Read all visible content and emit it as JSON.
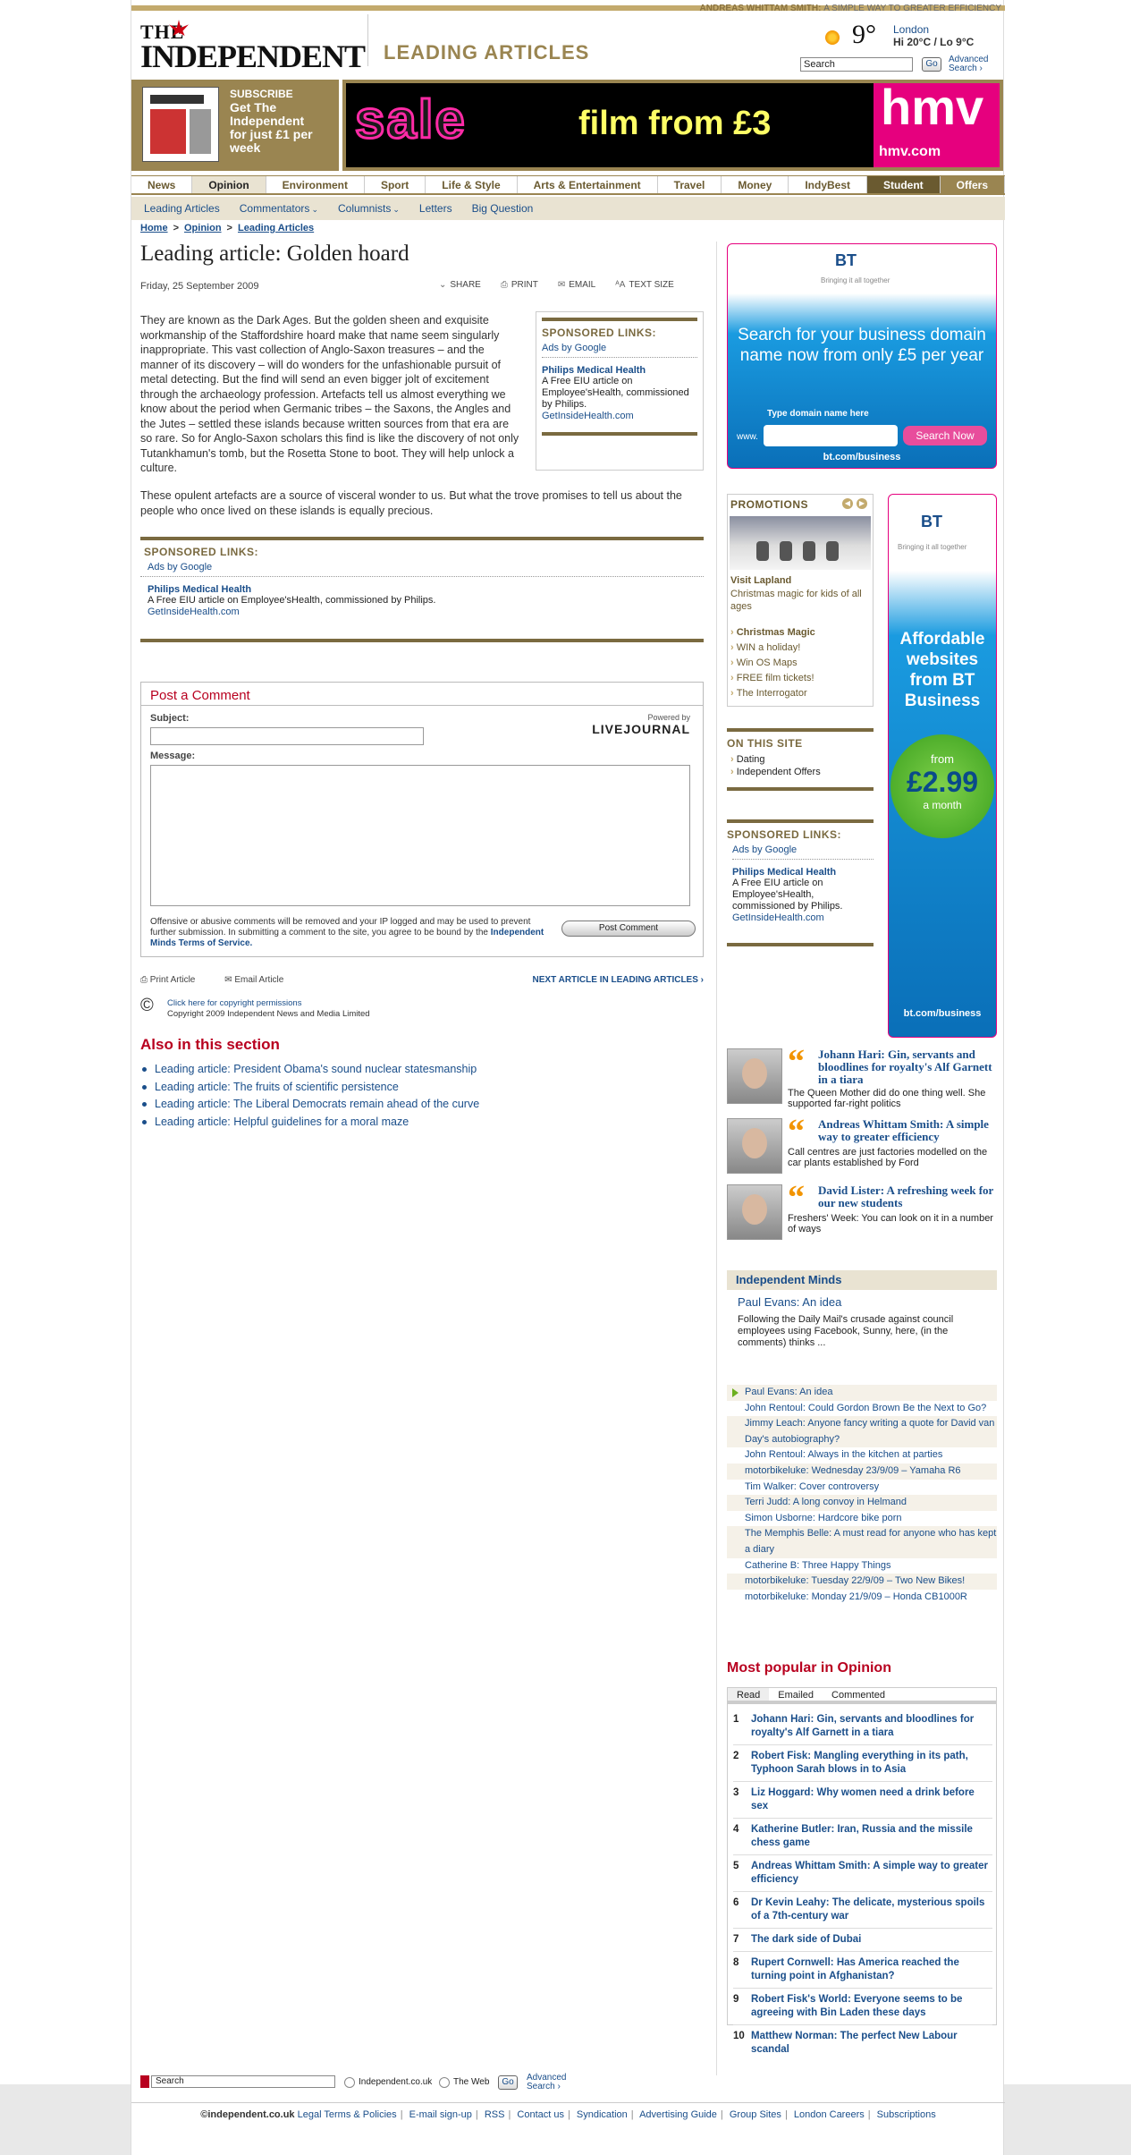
{
  "header": {
    "top_link_name": "ANDREAS WHITTAM SMITH:",
    "top_link_text": "A SIMPLE WAY TO GREATER EFFICIENCY",
    "logo_the": "THE",
    "logo_ind": "INDEPENDENT",
    "section_title": "LEADING ARTICLES",
    "weather_temp": "9°",
    "weather_city": "London",
    "weather_hilo": "Hi 20°C / Lo 9°C",
    "search_placeholder": "Search",
    "go": "Go",
    "advanced": "Advanced",
    "advanced2": "Search ›"
  },
  "subscribe": {
    "l1": "SUBSCRIBE",
    "l2": "Get The",
    "l3": "Independent",
    "l4": "for just £1 per",
    "l5": "week"
  },
  "banner": {
    "sale": "sale",
    "film": "film from £3",
    "brand": "hmv",
    "url": "hmv.com"
  },
  "nav": {
    "tabs": [
      "News",
      "Opinion",
      "Environment",
      "Sport",
      "Life & Style",
      "Arts & Entertainment",
      "Travel",
      "Money",
      "IndyBest",
      "Student",
      "Offers"
    ],
    "sub": [
      "Leading Articles",
      "Commentators",
      "Columnists",
      "Letters",
      "Big Question"
    ]
  },
  "breadcrumb": {
    "home": "Home",
    "opinion": "Opinion",
    "leading": "Leading Articles",
    "sep": ">"
  },
  "article": {
    "title": "Leading article: Golden hoard",
    "date": "Friday, 25 September 2009",
    "tools": [
      "SHARE",
      "PRINT",
      "EMAIL",
      "TEXT SIZE"
    ],
    "para1": "They are known as the Dark Ages. But the golden sheen and exquisite workmanship of the Staffordshire hoard make that name seem singularly inappropriate. This vast collection of Anglo-Saxon treasures – and the manner of its discovery – will do wonders for the unfashionable pursuit of metal detecting. But the find will send an even bigger jolt of excitement through the archaeology profession. Artefacts tell us almost everything we know about the period when Germanic tribes – the Saxons, the Angles and the Jutes – settled these islands because written sources from that era are so rare. So for Anglo-Saxon scholars this find is like the discovery of not only Tutankhamun's tomb, but the Rosetta Stone to boot. They will help unlock a culture.",
    "para2": "These opulent artefacts are a source of visceral wonder to us. But what the trove promises to tell us about the people who once lived on these islands is equally precious."
  },
  "sponsored": {
    "heading": "SPONSORED LINKS:",
    "ads": "Ads by Google",
    "title": "Philips Medical Health",
    "desc": "A Free EIU article on Employee'sHealth, commissioned by Philips.",
    "url": "GetInsideHealth.com"
  },
  "comment": {
    "heading": "Post a Comment",
    "subject": "Subject:",
    "message": "Message:",
    "powered": "Powered by",
    "lj": "LIVEJOURNAL",
    "note": "Offensive or abusive comments will be removed and your IP logged and may be used to prevent further submission. In submitting a comment to the site, you agree to be bound by the",
    "terms": "Independent Minds Terms of Service.",
    "post": "Post Comment"
  },
  "article_footer": {
    "print": "Print Article",
    "email": "Email Article",
    "next": "NEXT ARTICLE IN LEADING ARTICLES ›",
    "copyright_link": "Click here for copyright permissions",
    "copyright": "Copyright 2009 Independent News and Media Limited"
  },
  "also": {
    "heading": "Also in this section",
    "items": [
      "Leading article: President Obama's sound nuclear statesmanship",
      "Leading article: The fruits of scientific persistence",
      "Leading article: The Liberal Democrats remain ahead of the curve",
      "Leading article: Helpful guidelines for a moral maze"
    ]
  },
  "bt_ad": {
    "logo": "BT",
    "tag": "Bringing it all together",
    "headline": "Search for your business domain name now from only £5 per year",
    "label": "Type domain name here",
    "www": "www.",
    "button": "Search Now",
    "url": "bt.com/business"
  },
  "bt_ad2": {
    "headline": "Affordable websites from BT Business",
    "from": "from",
    "price": "£2.99",
    "month": "a month",
    "url": "bt.com/business"
  },
  "promotions": {
    "heading": "PROMOTIONS",
    "title": "Visit Lapland",
    "desc": "Christmas magic for kids of all ages",
    "items": [
      "Christmas Magic",
      "WIN a holiday!",
      "Win OS Maps",
      "FREE film tickets!",
      "The Interrogator"
    ]
  },
  "onsite": {
    "heading": "ON THIS SITE",
    "items": [
      "Dating",
      "Independent Offers"
    ]
  },
  "commentators": [
    {
      "title": "Johann Hari: Gin, servants and bloodlines for royalty's Alf Garnett in a tiara",
      "desc": "The Queen Mother did do one thing well. She supported far-right politics"
    },
    {
      "title": "Andreas Whittam Smith: A simple way to greater efficiency",
      "desc": "Call centres are just factories modelled on the car plants established by Ford"
    },
    {
      "title": "David Lister: A refreshing week for our new students",
      "desc": "Freshers' Week: You can look on it in a number of ways"
    }
  ],
  "minds": {
    "heading": "Independent Minds",
    "feature": "Paul Evans: An idea",
    "feature_desc": "Following the Daily Mail's crusade against council employees using Facebook, Sunny, here, (in the comments) thinks ...",
    "items": [
      "Paul Evans: An idea",
      "John Rentoul: Could Gordon Brown Be the Next to Go?",
      "Jimmy Leach: Anyone fancy writing a quote for David van Day's autobiography?",
      "John Rentoul: Always in the kitchen at parties",
      "motorbikeluke: Wednesday 23/9/09 – Yamaha R6",
      "Tim Walker: Cover controversy",
      "Terri Judd: A long convoy in Helmand",
      "Simon Usborne: Hardcore bike porn",
      "The Memphis Belle: A must read for anyone who has kept a diary",
      "Catherine B: Three Happy Things",
      "motorbikeluke: Tuesday 22/9/09 – Two New Bikes!",
      "motorbikeluke: Monday 21/9/09 – Honda CB1000R"
    ]
  },
  "popular": {
    "heading": "Most popular in Opinion",
    "tabs": [
      "Read",
      "Emailed",
      "Commented"
    ],
    "items": [
      "Johann Hari: Gin, servants and bloodlines for royalty's Alf Garnett in a tiara",
      "Robert Fisk: Mangling everything in its path, Typhoon Sarah blows in to Asia",
      "Liz Hoggard: Why women need a drink before sex",
      "Katherine Butler: Iran, Russia and the missile chess game",
      "Andreas Whittam Smith: A simple way to greater efficiency",
      "Dr Kevin Leahy: The delicate, mysterious spoils of a 7th-century war",
      "The dark side of Dubai",
      "Rupert Cornwell: Has America reached the turning point in Afghanistan?",
      "Robert Fisk's World: Everyone seems to be agreeing with Bin Laden these days",
      "Matthew Norman: The perfect New Labour scandal"
    ]
  },
  "footer_search": {
    "placeholder": "Search",
    "opt1": "Independent.co.uk",
    "opt2": "The Web",
    "go": "Go",
    "adv1": "Advanced",
    "adv2": "Search ›"
  },
  "footer": {
    "brand": "©independent.co.uk",
    "links": [
      "Legal Terms & Policies",
      "E-mail sign-up",
      "RSS",
      "Contact us",
      "Syndication",
      "Advertising Guide",
      "Group Sites",
      "London Careers",
      "Subscriptions"
    ]
  }
}
